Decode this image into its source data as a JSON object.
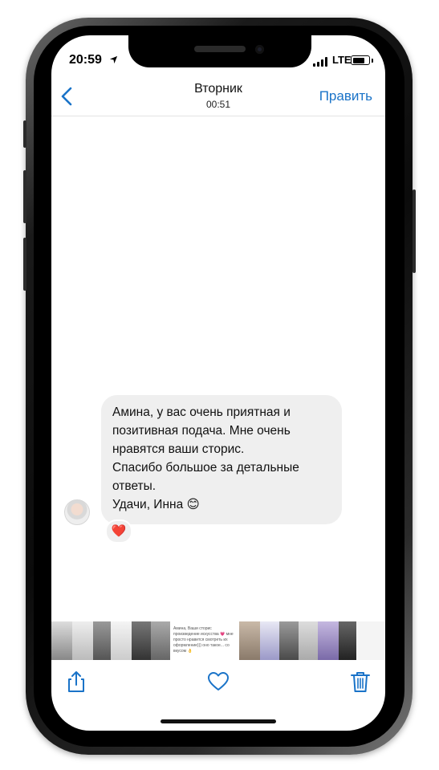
{
  "status_bar": {
    "time": "20:59",
    "network": "LTE",
    "battery_level": 0.8
  },
  "nav": {
    "title": "Вторник",
    "subtitle": "00:51",
    "edit_label": "Править",
    "back_icon": "chevron-left-icon"
  },
  "message": {
    "lines": [
      "Амина, у вас очень приятная и",
      "позитивная подача. Мне очень",
      "нравятся ваши сторис.",
      "Спасибо большое за детальные",
      "ответы.",
      "Удачи, Инна 😊"
    ],
    "reaction": "❤️"
  },
  "thumbnail_text": "Амина, Ваши сторис произведение искусства 💗 мне просто нравится смотреть их оформление))) оно такое... со вкусом 👌",
  "colors": {
    "accent": "#1a73c8",
    "bubble": "#efefef",
    "reaction": "#e0202c"
  },
  "toolbar": {
    "share_icon": "share-icon",
    "like_icon": "heart-icon",
    "delete_icon": "trash-icon"
  }
}
